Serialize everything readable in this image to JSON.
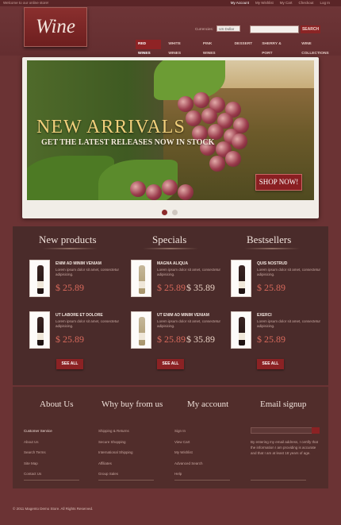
{
  "topbar": {
    "welcome": "Welcome to our online store!",
    "links": [
      "My Account",
      "My Wishlist",
      "My Cart",
      "Checkout",
      "Log In"
    ]
  },
  "header": {
    "logo": "Wine",
    "currency_label": "Currencies:",
    "currency_value": "US Dollar",
    "search_button": "SEARCH"
  },
  "nav": [
    "RED WINES",
    "WHITE WINES",
    "PINK WINES",
    "DESSERT",
    "SHERRY & PORT",
    "WINE COLLECTIONS"
  ],
  "banner": {
    "headline": "NEW ARRIVALS",
    "subline": "GET THE LATEST RELEASES NOW IN STOCK",
    "cta": "SHOP NOW!",
    "slide_count": 2,
    "active_slide": 1
  },
  "columns": [
    {
      "title": "New products",
      "see_all": "SEE ALL",
      "items": [
        {
          "name": "ENIM AD MINIM VENIAM",
          "desc": "Lorem ipsum dolor sit amet, consectetur adipisicing.",
          "price": "$ 25.89",
          "old_price": ""
        },
        {
          "name": "UT LABORE ET DOLORE",
          "desc": "Lorem ipsum dolor sit amet, consectetur adipisicing.",
          "price": "$ 25.89",
          "old_price": ""
        }
      ]
    },
    {
      "title": "Specials",
      "see_all": "SEE ALL",
      "items": [
        {
          "name": "MAGNA ALIQUA",
          "desc": "Lorem ipsum dolor sit amet, consectetur adipisicing.",
          "price": "$ 25.89",
          "old_price": "$ 35.89"
        },
        {
          "name": "UT ENIM AD MINIM VENIAM",
          "desc": "Lorem ipsum dolor sit amet, consectetur adipisicing.",
          "price": "$ 25.89",
          "old_price": "$ 35.89"
        }
      ]
    },
    {
      "title": "Bestsellers",
      "see_all": "SEE ALL",
      "items": [
        {
          "name": "QUIS NOSTRUD",
          "desc": "Lorem ipsum dolor sit amet, consectetur adipisicing.",
          "price": "$ 25.89",
          "old_price": ""
        },
        {
          "name": "EXERCI",
          "desc": "Lorem ipsum dolor sit amet, consectetur adipisicing.",
          "price": "$ 25.89",
          "old_price": ""
        }
      ]
    }
  ],
  "footer": {
    "about": {
      "title": "About Us",
      "links": [
        "Customer Service",
        "About Us",
        "Search Terms",
        "Site Map",
        "Contact Us"
      ]
    },
    "why": {
      "title": "Why buy from us",
      "links": [
        "Shipping & Returns",
        "Secure Shopping",
        "International Shipping",
        "Affiliates",
        "Group Sales"
      ]
    },
    "account": {
      "title": "My account",
      "links": [
        "Sign In",
        "View Cart",
        "My Wishlist",
        "Advanced Search",
        "Help"
      ]
    },
    "email": {
      "title": "Email signup",
      "text": "By entering my email address, I certify that the information I am providing is accurate and that I am at least 18 years of age."
    },
    "copyright": "© 2011 Magento Demo Store. All Rights Reserved."
  },
  "colors": {
    "accent": "#8b2224",
    "price": "#d96a5c"
  }
}
